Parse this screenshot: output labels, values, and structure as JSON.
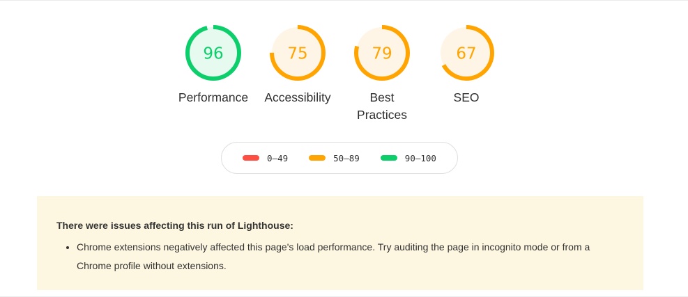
{
  "gauges": [
    {
      "score": "96",
      "label": "Performance",
      "value": 0.96,
      "color": "#0cce6b",
      "fill": "#e6faef"
    },
    {
      "score": "75",
      "label": "Accessibility",
      "value": 0.75,
      "color": "#ffa400",
      "fill": "#fff5e6"
    },
    {
      "score": "79",
      "label": "Best Practices",
      "value": 0.79,
      "color": "#ffa400",
      "fill": "#fff5e6"
    },
    {
      "score": "67",
      "label": "SEO",
      "value": 0.67,
      "color": "#ffa400",
      "fill": "#fff5e6"
    }
  ],
  "legend": [
    {
      "range": "0–49",
      "color": "#ff4e42"
    },
    {
      "range": "50–89",
      "color": "#ffa400"
    },
    {
      "range": "90–100",
      "color": "#0cce6b"
    }
  ],
  "warning": {
    "title": "There were issues affecting this run of Lighthouse:",
    "items": [
      "Chrome extensions negatively affected this page's load performance. Try auditing the page in incognito mode or from a Chrome profile without extensions."
    ],
    "background": "#fdf6e0"
  }
}
